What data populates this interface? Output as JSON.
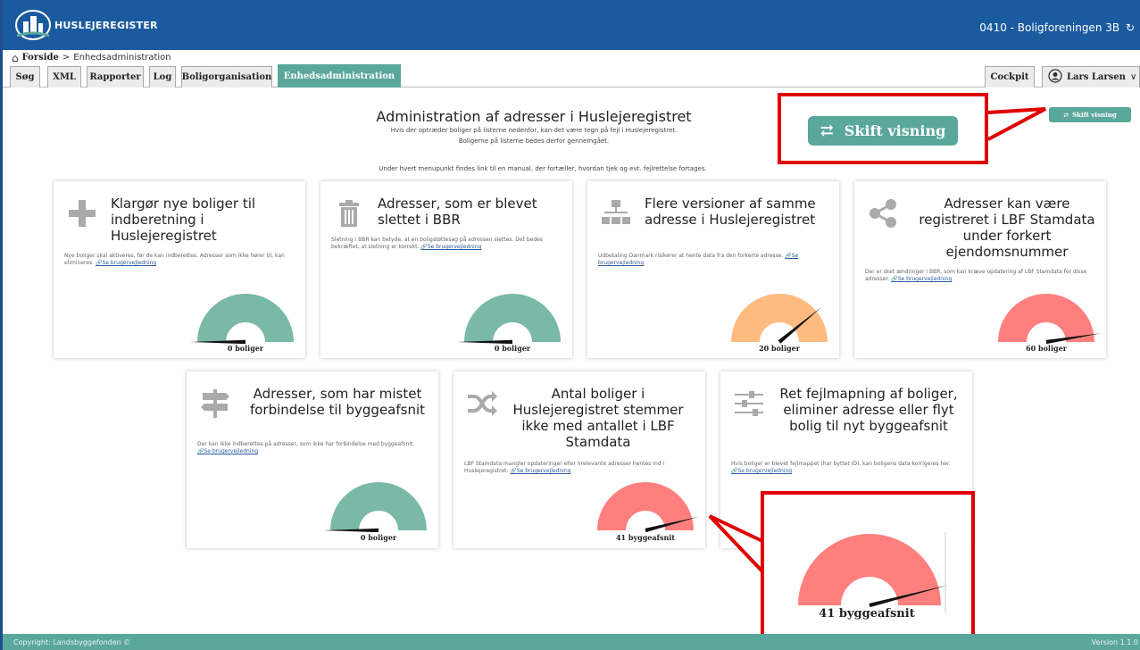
{
  "header": {
    "logo_text": "HUSLEJEREGISTER",
    "organization": "0410 - Boligforeningen 3B"
  },
  "breadcrumb": {
    "home": "Forside",
    "separator": ">",
    "current": "Enhedsadministration"
  },
  "nav": {
    "tabs": [
      "Søg",
      "XML",
      "Rapporter",
      "Log",
      "Boligorganisation",
      "Enhedsadministration"
    ],
    "active_tab": "Enhedsadministration",
    "cockpit": "Cockpit",
    "user": "Lars Larsen"
  },
  "page": {
    "title": "Administration af adresser i Huslejeregistret",
    "subtitle_line1": "Hvis der optræder boliger på listerne nedenfor, kan det være tegn på fejl i Huslejeregistret.",
    "subtitle_line2": "Boligerne på listerne bedes derfor gennemgået.",
    "instructions": "Under hvert menupunkt findes link til en manual, der fortæller, hvordan tjek og evt. fejlrettelse fortages.",
    "skift_visning": "Skift visning"
  },
  "cards": [
    {
      "title": "Klargør nye boliger til indberetning i Huslejeregistret",
      "desc": "Nye boliger skal aktiveres, før de kan indberettes. Adresser som ikke hører til, kan elimineres.",
      "link": "Se brugervejledning",
      "count_label": "0 boliger",
      "level": 0,
      "color": "#7ab8a8",
      "icon": "plus-icon"
    },
    {
      "title": "Adresser, som er blevet slettet i BBR",
      "desc": "Sletning i BBR kan betyde, at en boligstøttesag på adressen slettes. Det bedes bekræftet, at sletning er korrekt.",
      "link": "Se brugervejledning",
      "count_label": "0 boliger",
      "level": 0,
      "color": "#7ab8a8",
      "icon": "trash-icon"
    },
    {
      "title": "Flere versioner af samme adresse i Huslejeregistret",
      "desc": "Udbetaling Danmark risikerer at hente data fra den forkerte adresse.",
      "link": "Se brugervejledning",
      "count_label": "20 boliger",
      "level": 0.78,
      "color": "#ffbb80",
      "icon": "sitemap-icon"
    },
    {
      "title": "Adresser kan være registreret i LBF Stamdata under forkert ejendomsnummer",
      "desc": "Der er sket ændringer i BBR, som kan kræve opdatering af LBF Stamdata for disse adresser.",
      "link": "Se brugervejledning",
      "count_label": "60 boliger",
      "level": 0.95,
      "color": "#ff7f7f",
      "icon": "share-icon"
    },
    {
      "title": "Adresser, som har mistet forbindelse til byggeafsnit",
      "desc": "Der kan ikke indberettes på adresser, som ikke har forbindelse med byggeafsnit.",
      "link": "Se brugervejledning",
      "count_label": "0 boliger",
      "level": 0,
      "color": "#7ab8a8",
      "icon": "signpost-icon"
    },
    {
      "title": "Antal boliger i Huslejeregistret stemmer ikke med antallet i LBF Stamdata",
      "desc": "LBF Stamdata mangler opdateringer eller irrelevante adresser hentes ind i Huslejeregistret.",
      "link": "Se brugervejledning",
      "count_label": "41 byggeafsnit",
      "level": 0.92,
      "color": "#ff7f7f",
      "icon": "shuffle-icon"
    },
    {
      "title": "Ret fejlmapning af boliger, eliminer adresse eller flyt bolig til nyt byggeafsnit",
      "desc": "Hvis boliger er blevet fejlmappet (har byttet ID), kan boligens data korrigeres her.",
      "link": "Se brugervejledning",
      "icon": "sliders-icon"
    }
  ],
  "zoom_callout": {
    "count_label": "41 byggeafsnit",
    "level": 0.92,
    "color": "#ff7f7f"
  },
  "footer": {
    "copyright": "Copyright: Landsbyggefonden ©",
    "version": "Version 1.1.0"
  }
}
